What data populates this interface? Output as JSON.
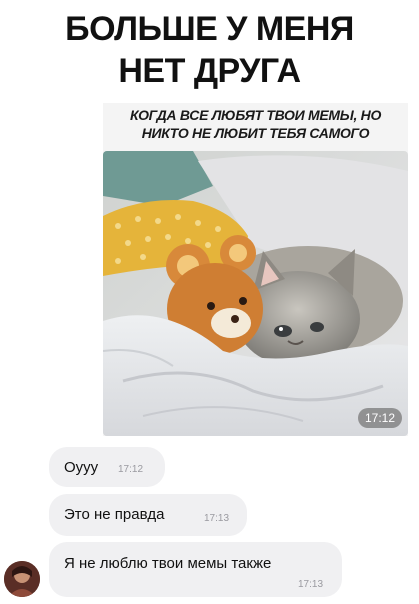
{
  "meme": {
    "headline_line1": "БОЛЬШЕ У МЕНЯ",
    "headline_line2": "НЕТ ДРУГА",
    "caption_line1": "КОГДА ВСЕ ЛЮБЯТ ТВОИ МЕМЫ, НО",
    "caption_line2": "НИКТО НЕ ЛЮБИТ ТЕБЯ САМОГО"
  },
  "photo_message": {
    "time": "17:12"
  },
  "messages": [
    {
      "text": "Оууу",
      "time": "17:12"
    },
    {
      "text": "Это не правда",
      "time": "17:13"
    },
    {
      "text": "Я не люблю твои мемы также",
      "time": "17:13"
    }
  ],
  "colors": {
    "bubble_bg": "#f0f0f2",
    "time_text": "#9a9aa0",
    "background": "#ffffff"
  }
}
